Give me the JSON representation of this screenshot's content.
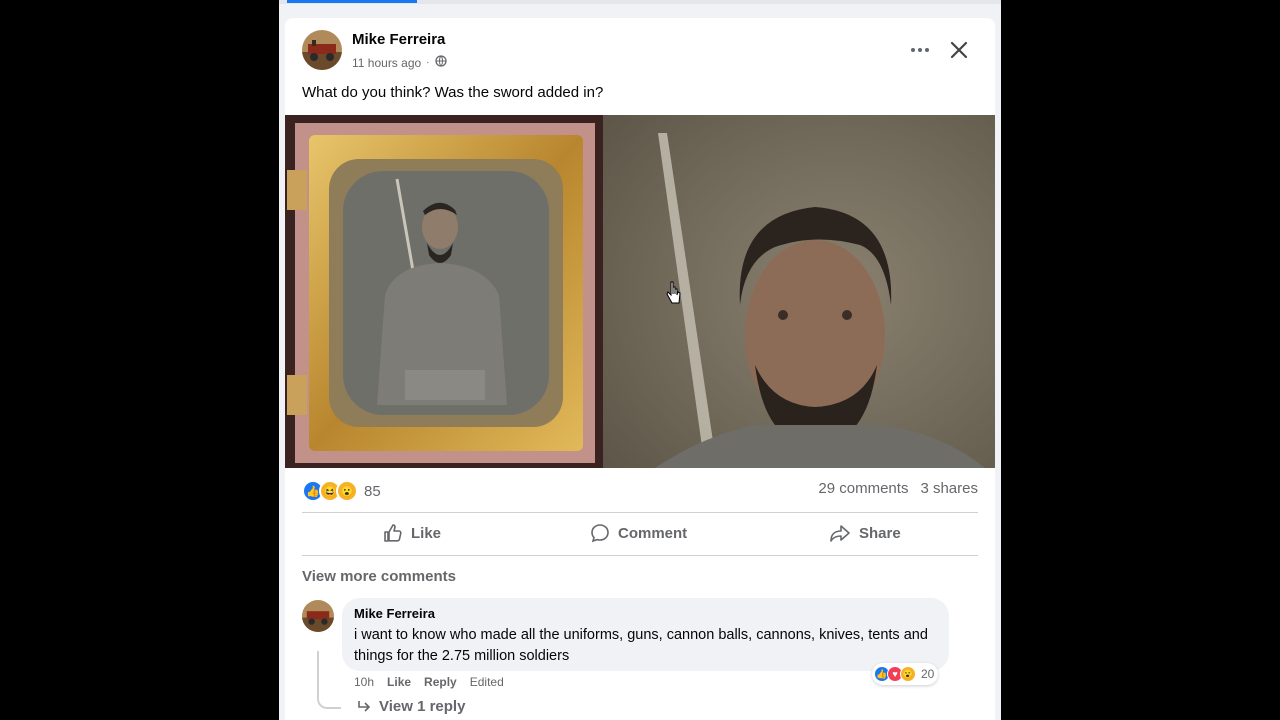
{
  "post": {
    "author": "Mike Ferreira",
    "time": "11 hours ago",
    "separator": "·",
    "text": "What do you think?  Was the sword added in?"
  },
  "stats": {
    "reaction_count": "85",
    "comments": "29 comments",
    "shares": "3 shares"
  },
  "actions": {
    "like": "Like",
    "comment": "Comment",
    "share": "Share"
  },
  "comments_section": {
    "view_more": "View more comments",
    "comment": {
      "author": "Mike Ferreira",
      "text": "i want to know who made all the uniforms, guns, cannon balls, cannons, knives, tents and things for the 2.75 million soldiers",
      "time": "10h",
      "like": "Like",
      "reply": "Reply",
      "edited": "Edited",
      "reaction_count": "20"
    },
    "view_reply": "View 1 reply"
  },
  "colors": {
    "accent": "#1877f2",
    "like_blue": "#1877f2",
    "love_red": "#f33e58",
    "haha_yellow": "#f7b125"
  }
}
